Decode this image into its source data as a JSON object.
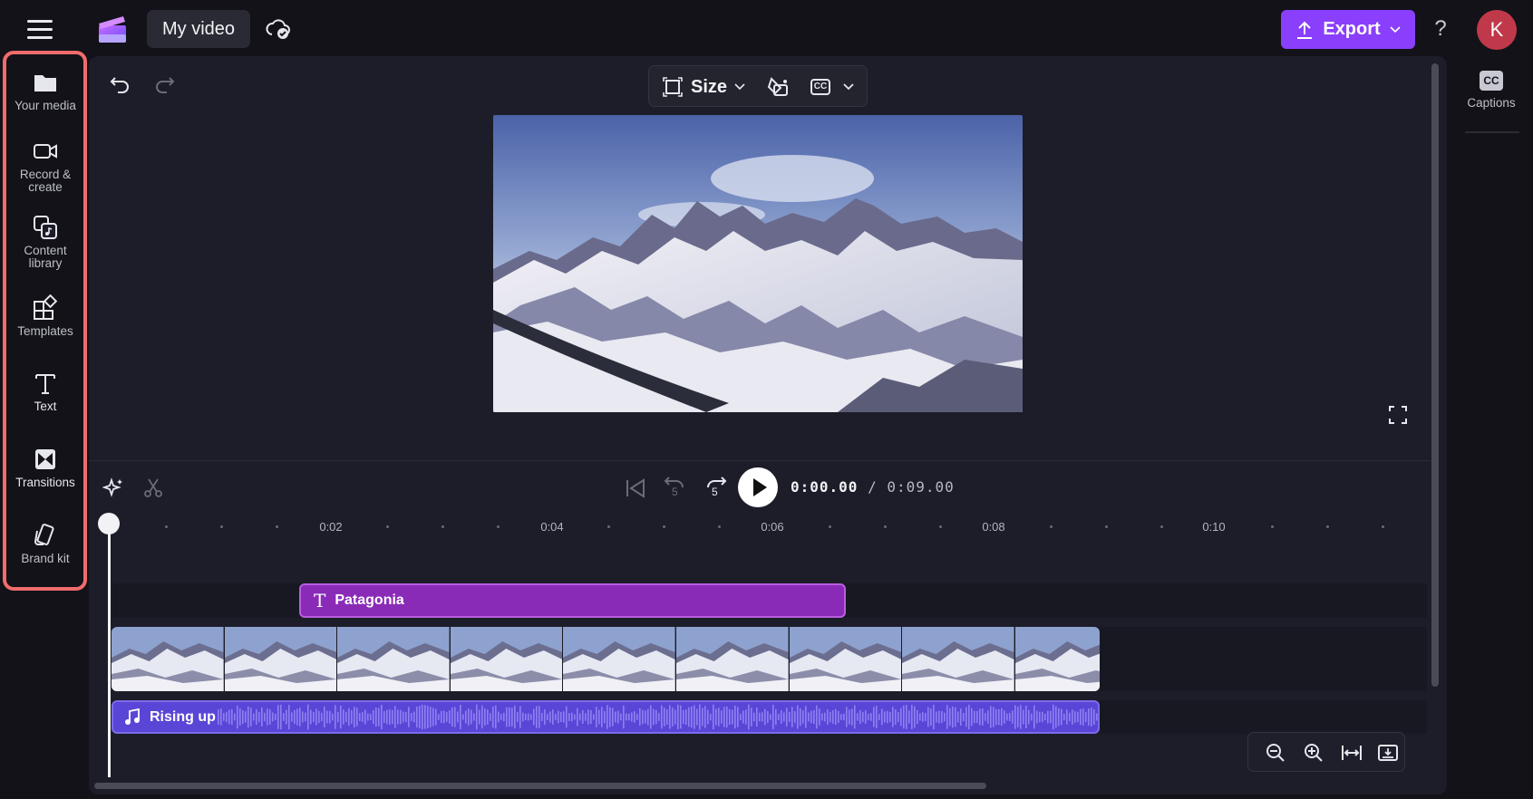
{
  "app": {
    "project_title": "My video",
    "export_label": "Export",
    "help_label": "?",
    "avatar_initial": "K",
    "accent_color": "#8a3ffc"
  },
  "sidebar": {
    "items": [
      {
        "label": "Your media",
        "icon": "folder-icon"
      },
      {
        "label": "Record & create",
        "icon": "video-camera-icon"
      },
      {
        "label": "Content library",
        "icon": "content-library-icon"
      },
      {
        "label": "Templates",
        "icon": "templates-icon"
      },
      {
        "label": "Text",
        "icon": "text-icon"
      },
      {
        "label": "Transitions",
        "icon": "transitions-icon"
      },
      {
        "label": "Brand kit",
        "icon": "brand-kit-icon"
      }
    ],
    "highlight_color": "#f06c6c"
  },
  "right_panel": {
    "captions_label": "Captions",
    "captions_icon_text": "CC"
  },
  "preview_toolbar": {
    "size_label": "Size",
    "cc_text": "CC"
  },
  "playback": {
    "current_time": "0:00.00",
    "separator": " / ",
    "duration": "0:09.00",
    "rewind_seconds": "5",
    "forward_seconds": "5"
  },
  "ruler": {
    "labels": [
      "0:02",
      "0:04",
      "0:06",
      "0:08",
      "0:10"
    ]
  },
  "timeline": {
    "text_clip": {
      "label": "Patagonia",
      "icon_glyph": "T",
      "color": "#8a2bb8"
    },
    "audio_clip": {
      "label": "Rising up",
      "color": "#5a46d6"
    }
  }
}
